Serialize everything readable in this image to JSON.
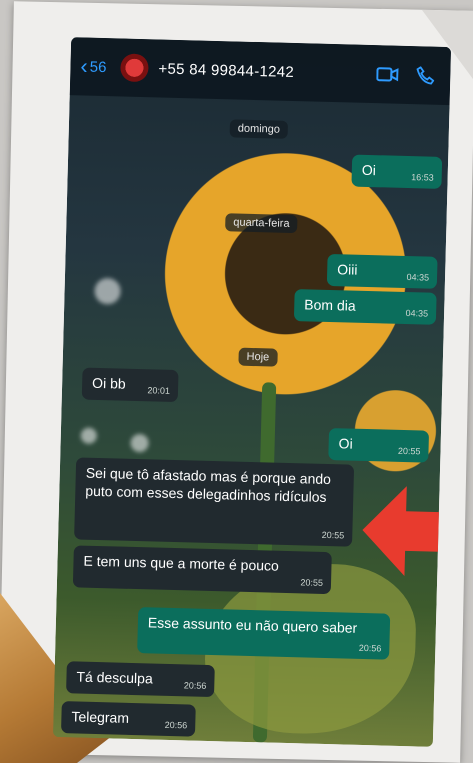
{
  "header": {
    "back_count": "56",
    "contact": "+55 84 99844-1242"
  },
  "chips": {
    "day1": "domingo",
    "day2": "quarta-feira",
    "day3": "Hoje"
  },
  "messages": [
    {
      "dir": "out",
      "text": "Oi",
      "time": "16:53"
    },
    {
      "dir": "out",
      "text": "Oiii",
      "time": "04:35"
    },
    {
      "dir": "out",
      "text": "Bom dia",
      "time": "04:35"
    },
    {
      "dir": "in",
      "text": "Oi bb",
      "time": "20:01"
    },
    {
      "dir": "out",
      "text": "Oi",
      "time": "20:55"
    },
    {
      "dir": "in",
      "text": "Sei que tô afastado mas é porque ando puto com esses delegadinhos ridículos",
      "time": "20:55"
    },
    {
      "dir": "in",
      "text": "E tem uns que a morte é pouco",
      "time": "20:55"
    },
    {
      "dir": "out",
      "text": "Esse assunto eu não quero saber",
      "time": "20:56"
    },
    {
      "dir": "in",
      "text": "Tá desculpa",
      "time": "20:56"
    },
    {
      "dir": "in",
      "text": "Telegram",
      "time": "20:56"
    }
  ],
  "colors": {
    "incoming": "#212a2f",
    "outgoing": "#0b6e5c",
    "accent": "#2e9bff",
    "arrow": "#e83b2e"
  }
}
